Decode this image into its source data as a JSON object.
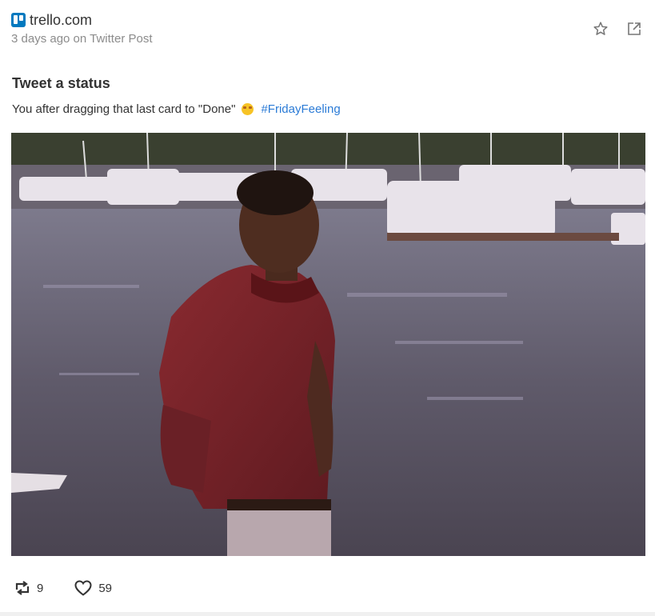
{
  "source": {
    "name": "trello.com",
    "icon": "trello-logo-icon",
    "brand_color": "#0079bf"
  },
  "meta": "3 days ago on Twitter Post",
  "actions": {
    "favorite_icon": "star-icon",
    "open_icon": "external-link-icon"
  },
  "post": {
    "title": "Tweet a status",
    "body_text": "You after dragging that last card to \"Done\"",
    "emoji_icon": "star-struck-emoji-icon",
    "hashtag": "#FridayFeeling",
    "hashtag_color": "#2b7bd6"
  },
  "media": {
    "icon": "gif-image"
  },
  "stats": {
    "retweets": "9",
    "retweet_icon": "retweet-icon",
    "likes": "59",
    "like_icon": "heart-icon"
  }
}
